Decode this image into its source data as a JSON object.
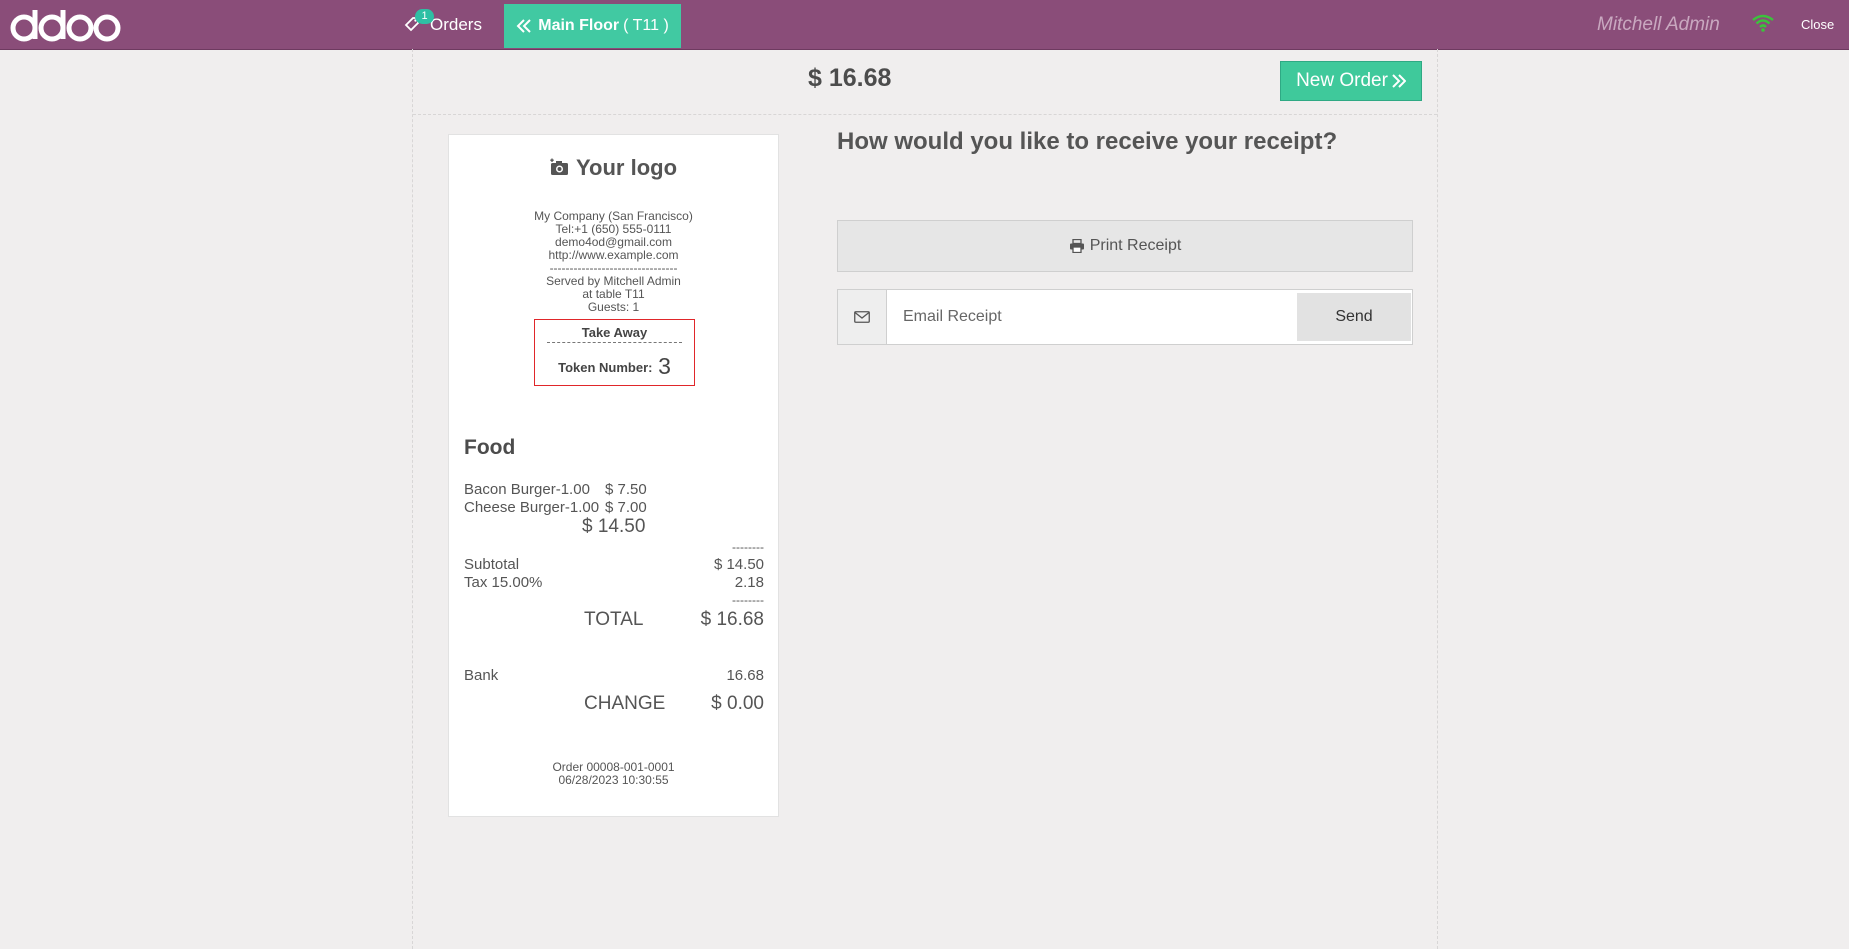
{
  "app": {
    "logo_text": "odoo"
  },
  "topbar": {
    "orders_label": "Orders",
    "orders_count": "1",
    "floor_label": "Main Floor",
    "table_label": "( T11 )",
    "user_name": "Mitchell Admin",
    "close_label": "Close",
    "wifi_status_color": "#3cc23c"
  },
  "screen": {
    "amount_due": "$ 16.68",
    "new_order_label": "New Order",
    "question": "How would you like to receive your receipt?",
    "print_receipt_label": "Print Receipt",
    "email_placeholder": "Email Receipt",
    "email_value": "",
    "send_label": "Send"
  },
  "receipt": {
    "logo_label": "Your logo",
    "company": "My Company (San Francisco)",
    "phone": "Tel:+1 (650) 555-0111",
    "email": "demo4od@gmail.com",
    "website": "http://www.example.com",
    "separator": "--------------------------------",
    "served_by": "Served by Mitchell Admin",
    "table": "at table T11",
    "guests": "Guests: 1",
    "take_away": "Take Away",
    "token_label": "Token Number:",
    "token_number": "3",
    "category": "Food",
    "lines": [
      {
        "name": "Bacon Burger-1.00",
        "price": "$ 7.50"
      },
      {
        "name": "Cheese Burger-1.00",
        "price": "$ 7.00"
      }
    ],
    "category_total": "$ 14.50",
    "dashes": "--------",
    "subtotal_label": "Subtotal",
    "subtotal_value": "$ 14.50",
    "tax_label": "Tax 15.00%",
    "tax_value": "2.18",
    "total_label": "TOTAL",
    "total_value": "$ 16.68",
    "payment_label": "Bank",
    "payment_value": "16.68",
    "change_label": "CHANGE",
    "change_value": "$ 0.00",
    "order_ref": "Order 00008-001-0001",
    "order_date": "06/28/2023 10:30:55",
    "highlight_color": "#e0262a"
  }
}
